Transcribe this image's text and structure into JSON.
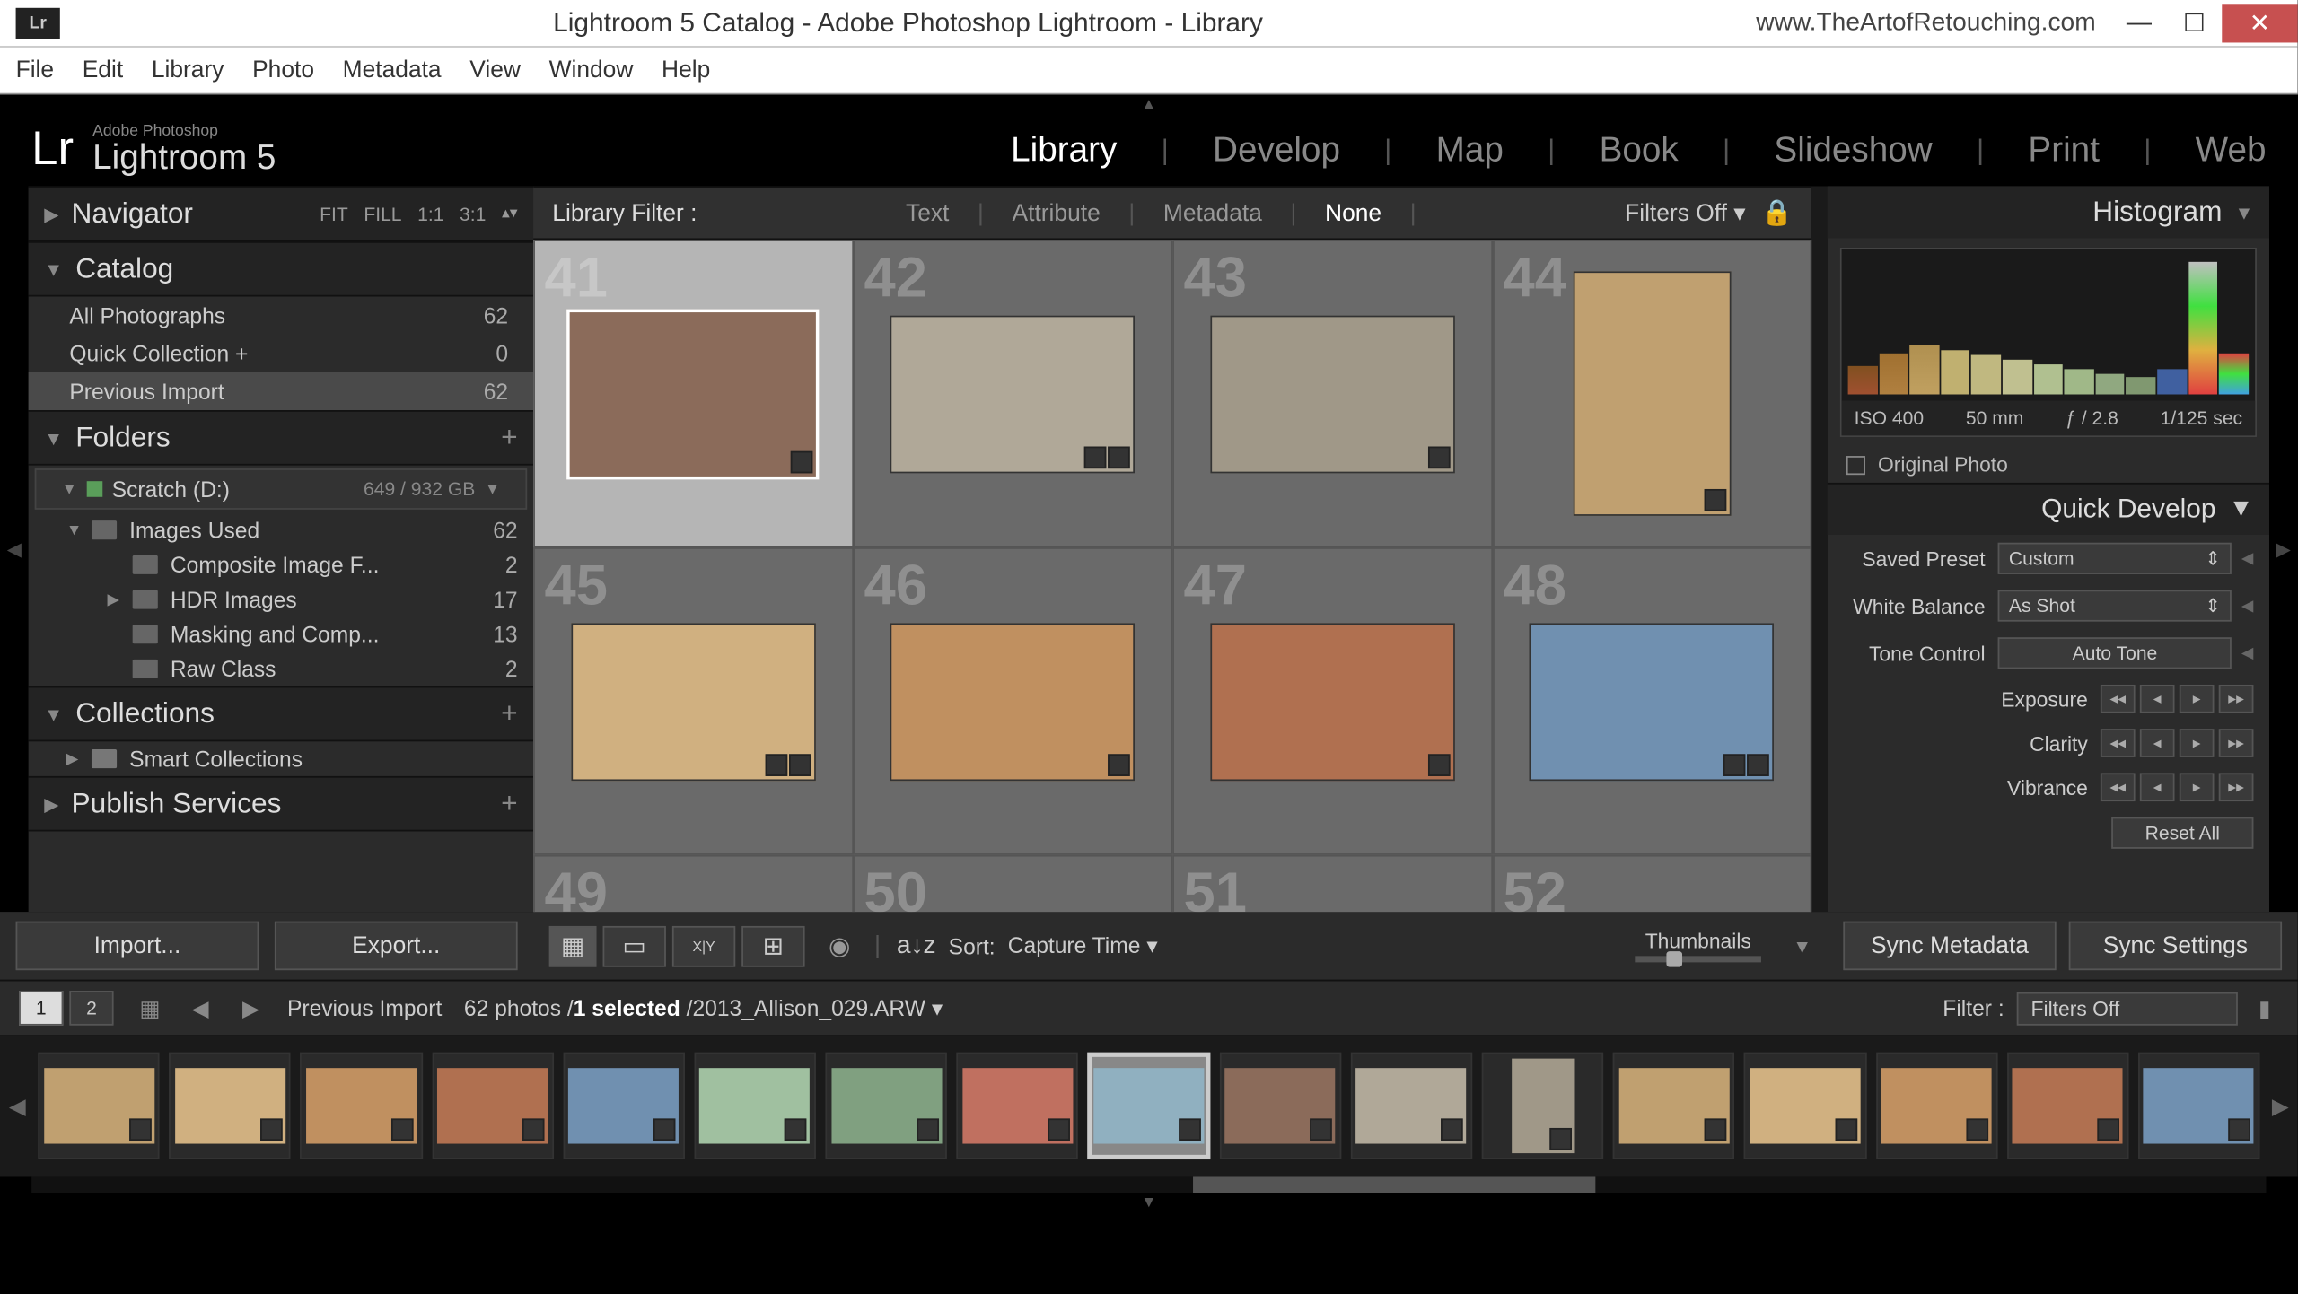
{
  "window": {
    "app_icon": "Lr",
    "title": "Lightroom 5 Catalog - Adobe Photoshop Lightroom - Library",
    "url": "www.TheArtofRetouching.com"
  },
  "menu": [
    "File",
    "Edit",
    "Library",
    "Photo",
    "Metadata",
    "View",
    "Window",
    "Help"
  ],
  "logo": {
    "small": "Adobe Photoshop",
    "big": "Lightroom 5",
    "mark": "Lr"
  },
  "modules": [
    "Library",
    "Develop",
    "Map",
    "Book",
    "Slideshow",
    "Print",
    "Web"
  ],
  "active_module": "Library",
  "navigator": {
    "title": "Navigator",
    "modes": [
      "FIT",
      "FILL",
      "1:1",
      "3:1"
    ]
  },
  "catalog": {
    "title": "Catalog",
    "items": [
      {
        "label": "All Photographs",
        "count": "62"
      },
      {
        "label": "Quick Collection  +",
        "count": "0"
      },
      {
        "label": "Previous Import",
        "count": "62"
      }
    ],
    "selected_index": 2
  },
  "folders": {
    "title": "Folders",
    "drive": {
      "label": "Scratch (D:)",
      "size": "649 / 932 GB"
    },
    "tree": [
      {
        "label": "Images Used",
        "count": "62",
        "indent": 0,
        "expanded": true
      },
      {
        "label": "Composite Image F...",
        "count": "2",
        "indent": 1
      },
      {
        "label": "HDR Images",
        "count": "17",
        "indent": 1,
        "expandable": true
      },
      {
        "label": "Masking and Comp...",
        "count": "13",
        "indent": 1
      },
      {
        "label": "Raw Class",
        "count": "2",
        "indent": 1
      }
    ]
  },
  "collections": {
    "title": "Collections",
    "items": [
      {
        "label": "Smart Collections"
      }
    ]
  },
  "publish": {
    "title": "Publish Services"
  },
  "filter_bar": {
    "label": "Library Filter :",
    "options": [
      "Text",
      "Attribute",
      "Metadata",
      "None"
    ],
    "active_option": "None",
    "filters_label": "Filters Off"
  },
  "grid": {
    "start_index": 41,
    "selected_index": 41,
    "cells": [
      41,
      42,
      43,
      44,
      45,
      46,
      47,
      48,
      49,
      50,
      51,
      52
    ],
    "tall_cells": [
      44
    ]
  },
  "histogram": {
    "title": "Histogram",
    "iso": "ISO 400",
    "focal": "50 mm",
    "aperture": "ƒ / 2.8",
    "shutter": "1/125 sec",
    "original_label": "Original Photo"
  },
  "quick_develop": {
    "title": "Quick Develop",
    "preset_label": "Saved Preset",
    "preset_value": "Custom",
    "wb_label": "White Balance",
    "wb_value": "As Shot",
    "tone_label": "Tone Control",
    "auto_tone": "Auto Tone",
    "controls": [
      "Exposure",
      "Clarity",
      "Vibrance"
    ],
    "reset": "Reset All"
  },
  "toolbar": {
    "import": "Import...",
    "export": "Export...",
    "sort_label": "Sort:",
    "sort_value": "Capture Time",
    "thumbnails_label": "Thumbnails",
    "sync_meta": "Sync Metadata",
    "sync_settings": "Sync Settings"
  },
  "info_row": {
    "pages": [
      "1",
      "2"
    ],
    "active_page": 0,
    "source": "Previous Import",
    "count_text_a": "62 photos /",
    "count_text_b": "1 selected",
    "count_text_c": " /2013_Allison_029.ARW",
    "filter_label": "Filter :",
    "filter_value": "Filters Off"
  },
  "filmstrip": {
    "count": 17,
    "selected_index": 8,
    "tall_indices": [
      11
    ]
  }
}
